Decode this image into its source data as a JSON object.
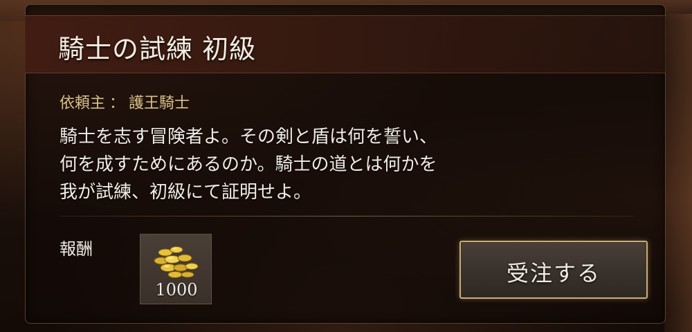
{
  "quest": {
    "title": "騎士の試練 初級",
    "client_label": "依頼主",
    "client_separator": "：",
    "client_name": "護王騎士",
    "description_lines": [
      "騎士を志す冒険者よ。その剣と盾は何を誓い、",
      "何を成すためにあるのか。騎士の道とは何かを",
      "我が試練、初級にて証明せよ。"
    ]
  },
  "reward": {
    "label": "報酬",
    "item_icon": "gold-coins-icon",
    "count": "1000"
  },
  "actions": {
    "accept_label": "受注する"
  },
  "colors": {
    "title_text": "#f3ede2",
    "client_text": "#d9c08a",
    "button_border": "#c9ad7a",
    "coin_gold": "#e8c23a"
  }
}
